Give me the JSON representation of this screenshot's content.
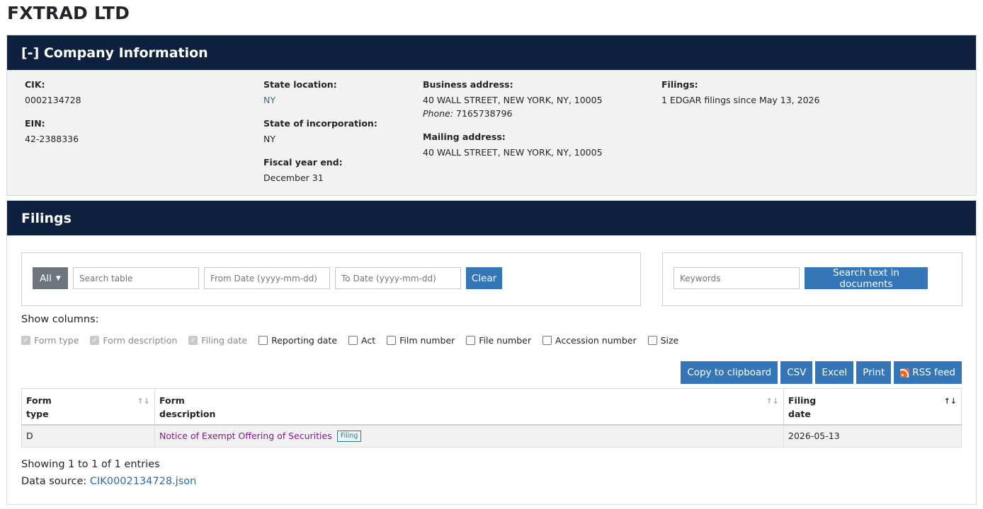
{
  "company": {
    "name": "FXTRAD LTD"
  },
  "info": {
    "header": "[-] Company Information",
    "cik_label": "CIK:",
    "cik": "0002134728",
    "ein_label": "EIN:",
    "ein": "42-2388336",
    "state_location_label": "State location:",
    "state_location": "NY",
    "state_incorp_label": "State of incorporation:",
    "state_incorp": "NY",
    "fiscal_label": "Fiscal year end:",
    "fiscal": "December 31",
    "business_label": "Business address:",
    "business_address": "40 WALL STREET, NEW YORK, NY, 10005",
    "phone_label": "Phone:",
    "phone": "7165738796",
    "mailing_label": "Mailing address:",
    "mailing_address": "40 WALL STREET, NEW YORK, NY, 10005",
    "filings_label": "Filings:",
    "filings_text": "1 EDGAR filings since May 13, 2026"
  },
  "filings": {
    "header": "Filings",
    "all_label": "All",
    "search_placeholder": "Search table",
    "from_placeholder": "From Date (yyyy-mm-dd)",
    "to_placeholder": "To Date (yyyy-mm-dd)",
    "clear_label": "Clear",
    "keywords_placeholder": "Keywords",
    "search_text_label": "Search text in documents",
    "show_columns_label": "Show columns:",
    "columns": [
      {
        "label": "Form type",
        "checked": true,
        "disabled": true
      },
      {
        "label": "Form description",
        "checked": true,
        "disabled": true
      },
      {
        "label": "Filing date",
        "checked": true,
        "disabled": true
      },
      {
        "label": "Reporting date",
        "checked": false,
        "disabled": false
      },
      {
        "label": "Act",
        "checked": false,
        "disabled": false
      },
      {
        "label": "Film number",
        "checked": false,
        "disabled": false
      },
      {
        "label": "File number",
        "checked": false,
        "disabled": false
      },
      {
        "label": "Accession number",
        "checked": false,
        "disabled": false
      },
      {
        "label": "Size",
        "checked": false,
        "disabled": false
      }
    ],
    "exports": {
      "copy": "Copy to clipboard",
      "csv": "CSV",
      "excel": "Excel",
      "print": "Print",
      "rss": "RSS feed"
    },
    "table": {
      "headers": {
        "form_type_1": "Form",
        "form_type_2": "type",
        "form_desc_1": "Form",
        "form_desc_2": "description",
        "filing_date_1": "Filing",
        "filing_date_2": "date"
      },
      "rows": [
        {
          "form_type": "D",
          "description": "Notice of Exempt Offering of Securities",
          "badge": "Filing",
          "filing_date": "2026-05-13"
        }
      ]
    },
    "showing": "Showing 1 to 1 of 1 entries",
    "data_source_label": "Data source:",
    "data_source_link": "CIK0002134728.json"
  },
  "colors": {
    "header_bg": "#0d213f",
    "button_blue": "#3576b8",
    "link_blue": "#2f6aa7",
    "visited_purple": "#7a1f84"
  }
}
